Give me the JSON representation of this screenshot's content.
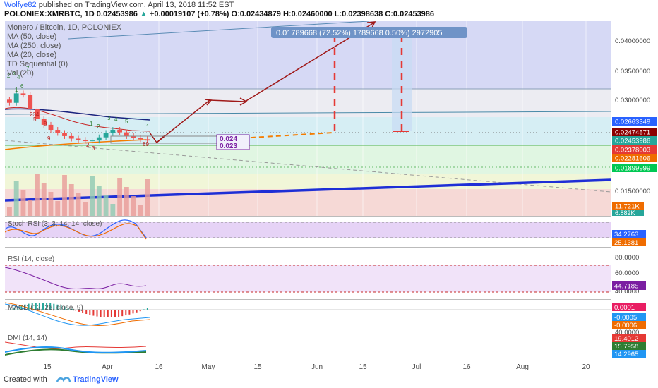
{
  "header": {
    "author": "Wolfye82",
    "published_text": "published on TradingView.com, April 13, 2018 11:52 EST",
    "symbol": "POLONIEX:XMRBTC, 1D",
    "last": "0.02453986",
    "change": "+0.00019107 (+0.78%)",
    "ohlc_o": "O:0.02434879",
    "ohlc_h": "H:0.02460000",
    "ohlc_l": "L:0.02398638",
    "ohlc_c": "C:0.02453986"
  },
  "main_pane": {
    "title": "Monero / Bitcoin, 1D, POLONIEX",
    "legend": [
      "MA (50, close)",
      "MA (250, close)",
      "MA (20, close)",
      "TD Sequential (0)",
      "Vol (20)"
    ],
    "measure_label": "0.01789668 (72.52%) 1789668  0.50%) 2972905",
    "target_label_1": "0.024",
    "target_label_2": "0.023",
    "td_counts": [
      "2",
      "3",
      "4",
      "6",
      "7",
      "1",
      "5",
      "8",
      "9",
      "234",
      "1",
      "2",
      "3",
      "4",
      "5",
      "1",
      "2",
      "3",
      "89"
    ],
    "price_ticks": [
      "0.04000000",
      "0.03500000",
      "0.03000000",
      "0.01500000"
    ],
    "price_labels": [
      {
        "text": "0.02663349",
        "color": "#2962ff"
      },
      {
        "text": "0.02474571",
        "color": "#8b0000"
      },
      {
        "text": "0.02453986",
        "color": "#26a69a"
      },
      {
        "text": "0.02378003",
        "color": "#e53935"
      },
      {
        "text": "0.02281606",
        "color": "#ef6c00"
      },
      {
        "text": "0.01899999",
        "color": "#00c853"
      },
      {
        "text": "11.721K",
        "color": "#ef6c00"
      },
      {
        "text": "6.882K",
        "color": "#26a69a"
      }
    ]
  },
  "stoch_pane": {
    "title": "Stoch RSI (3, 3, 14, 14, close)",
    "labels": [
      {
        "text": "34.2763",
        "color": "#2962ff"
      },
      {
        "text": "25.1381",
        "color": "#ef6c00"
      }
    ]
  },
  "rsi_pane": {
    "title": "RSI (14, close)",
    "ticks": [
      "80.0000",
      "60.0000",
      "40.0000"
    ],
    "labels": [
      {
        "text": "44.7185",
        "color": "#7b1fa2"
      }
    ]
  },
  "macd_pane": {
    "title": "MACD (12, 26, close, 9)",
    "labels": [
      {
        "text": "0.0001",
        "color": "#e91e63"
      },
      {
        "text": "-0.0005",
        "color": "#2196f3"
      },
      {
        "text": "-0.0006",
        "color": "#ef6c00"
      }
    ]
  },
  "dmi_pane": {
    "title": "DMI (14, 14)",
    "ticks": [
      "40.0000"
    ],
    "labels": [
      {
        "text": "19.4012",
        "color": "#e53935"
      },
      {
        "text": "15.7958",
        "color": "#2e7d32"
      },
      {
        "text": "14.2965",
        "color": "#2196f3"
      }
    ]
  },
  "x_axis": [
    "15",
    "Apr",
    "16",
    "May",
    "15",
    "Jun",
    "15",
    "Jul",
    "16",
    "Aug",
    "20"
  ],
  "footer": {
    "created_with": "Created with",
    "brand": "TradingView"
  },
  "chart_data": {
    "type": "line",
    "title": "Monero / Bitcoin, 1D, POLONIEX",
    "x_categories": [
      "15",
      "Apr",
      "16",
      "May",
      "15",
      "Jun",
      "15",
      "Jul",
      "16",
      "Aug",
      "20"
    ],
    "y_ticks": [
      0.04,
      0.035,
      0.03,
      0.015
    ],
    "ylim": [
      0.0125,
      0.0435
    ],
    "price_close": [
      0.0305,
      0.032,
      0.0318,
      0.0295,
      0.028,
      0.027,
      0.0262,
      0.0257,
      0.0252,
      0.0248,
      0.0246,
      0.0244,
      0.0245,
      0.025,
      0.0257,
      0.0262,
      0.0258,
      0.0252,
      0.0249,
      0.0247,
      0.0245
    ],
    "series": [
      {
        "name": "MA (50, close)",
        "last": 0.02663349
      },
      {
        "name": "MA (250, close)",
        "last": 0.02281606
      },
      {
        "name": "MA (20, close)",
        "last": 0.02474571
      }
    ],
    "last_price": 0.02453986,
    "support_level": 0.02378003,
    "level_label": 0.01899999,
    "projection_target_labels": [
      0.024,
      0.023
    ],
    "volume_labels": [
      "11.721K",
      "6.882K"
    ],
    "indicators": {
      "stoch_rsi": [
        34.2763,
        25.1381
      ],
      "rsi": 44.7185,
      "macd": [
        0.0001,
        -0.0005,
        -0.0006
      ],
      "dmi": [
        19.4012,
        15.7958,
        14.2965
      ]
    },
    "grid": true
  }
}
